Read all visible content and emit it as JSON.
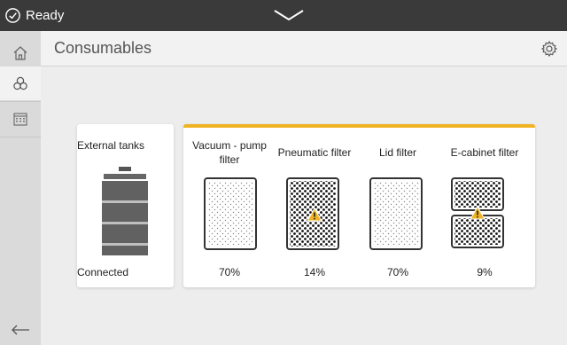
{
  "status": {
    "text": "Ready"
  },
  "header": {
    "title": "Consumables"
  },
  "sidebar": {
    "items": [
      {
        "name": "home"
      },
      {
        "name": "inks"
      },
      {
        "name": "calendar"
      }
    ]
  },
  "external_tanks": {
    "label": "External tanks",
    "status": "Connected"
  },
  "filters": [
    {
      "label": "Vacuum - pump filter",
      "value": "70%",
      "warning": false,
      "pattern": "light"
    },
    {
      "label": "Pneumatic filter",
      "value": "14%",
      "warning": true,
      "pattern": "dense"
    },
    {
      "label": "Lid filter",
      "value": "70%",
      "warning": false,
      "pattern": "light"
    },
    {
      "label": "E-cabinet filter",
      "value": "9%",
      "warning": true,
      "pattern": "split"
    }
  ],
  "colors": {
    "accent": "#f0b323",
    "statusbar": "#3a3a3a",
    "warning": "#f0b323"
  }
}
